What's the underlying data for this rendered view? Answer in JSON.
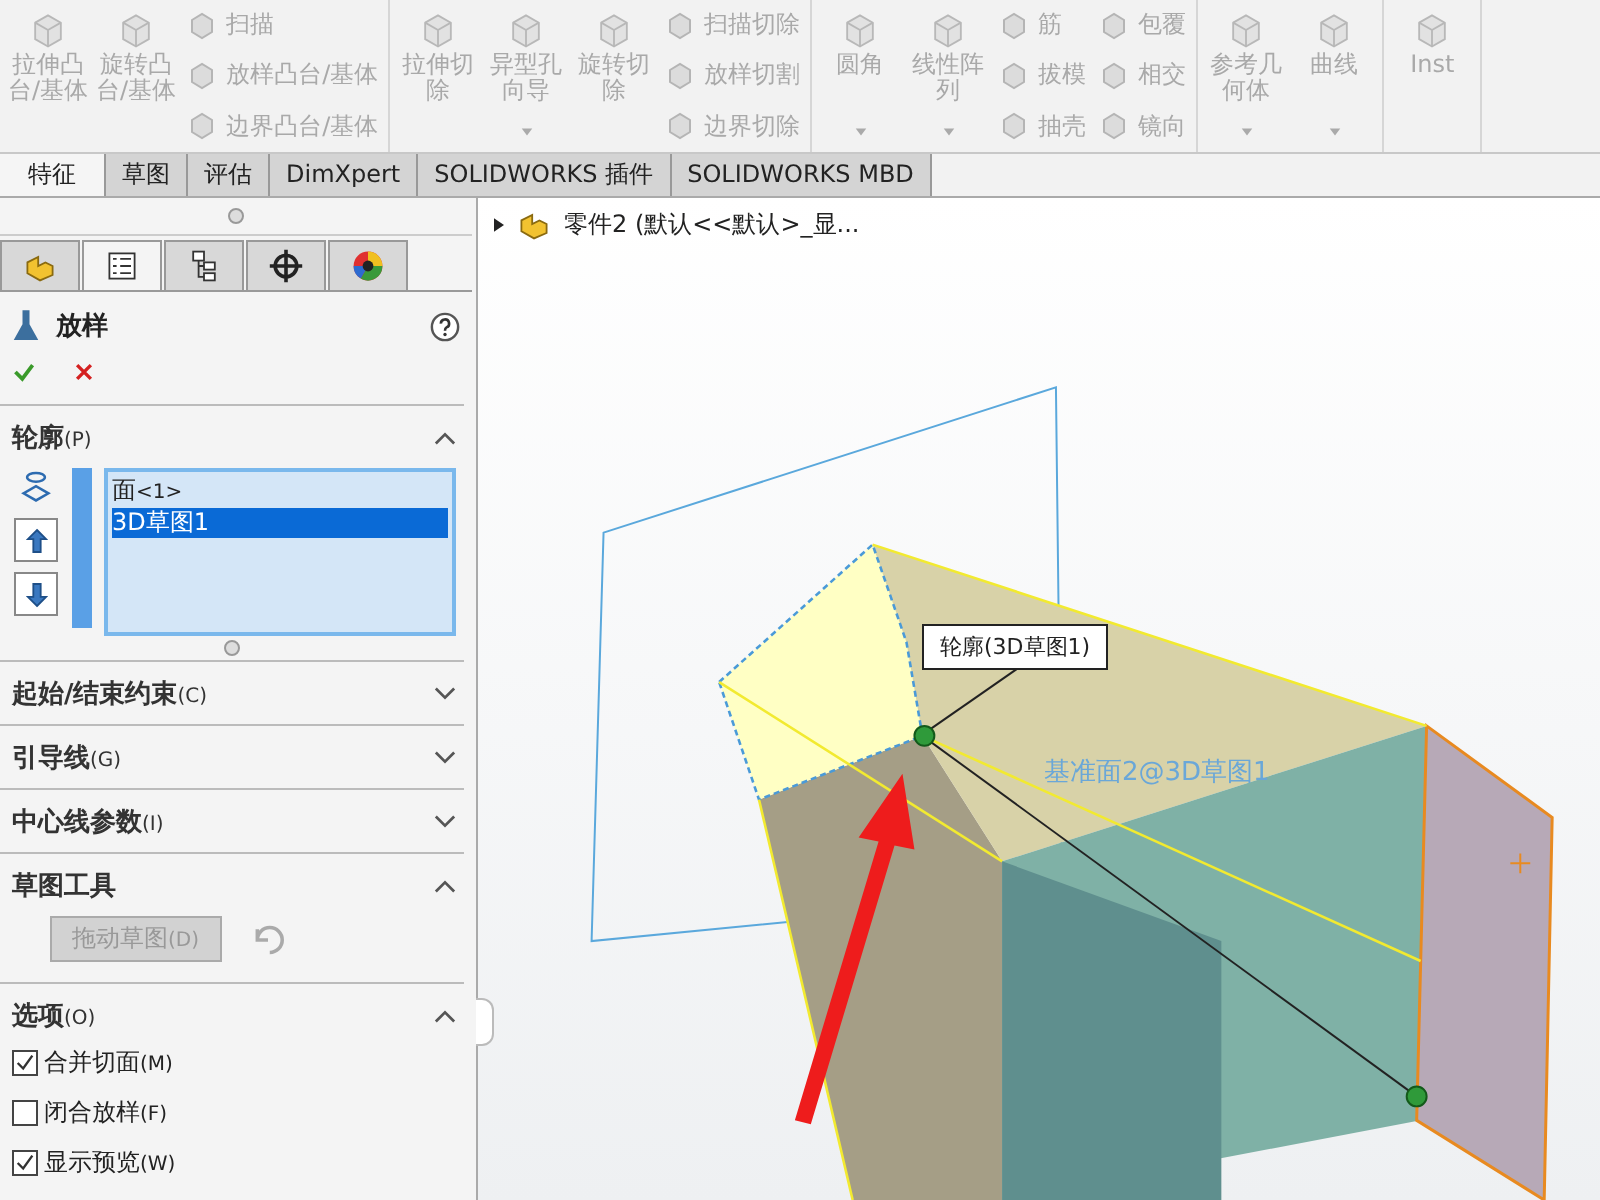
{
  "toolbar": {
    "groups": [
      {
        "items": [
          {
            "kind": "large",
            "lines": [
              "拉伸凸",
              "台/基体"
            ]
          },
          {
            "kind": "large",
            "lines": [
              "旋转凸",
              "台/基体"
            ]
          },
          {
            "kind": "column",
            "entries": [
              "扫描",
              "放样凸台/基体",
              "边界凸台/基体"
            ]
          }
        ]
      },
      {
        "items": [
          {
            "kind": "large",
            "lines": [
              "拉伸切",
              "除"
            ]
          },
          {
            "kind": "large",
            "lines": [
              "异型孔",
              "向导"
            ],
            "dropdown": true
          },
          {
            "kind": "large",
            "lines": [
              "旋转切",
              "除"
            ]
          },
          {
            "kind": "column",
            "entries": [
              "扫描切除",
              "放样切割",
              "边界切除"
            ]
          }
        ]
      },
      {
        "items": [
          {
            "kind": "large",
            "lines": [
              "圆角"
            ],
            "dropdown": true
          },
          {
            "kind": "large",
            "lines": [
              "线性阵",
              "列"
            ],
            "dropdown": true
          },
          {
            "kind": "column",
            "entries": [
              "筋",
              "拔模",
              "抽壳"
            ]
          },
          {
            "kind": "column",
            "entries": [
              "包覆",
              "相交",
              "镜向"
            ]
          }
        ]
      },
      {
        "items": [
          {
            "kind": "large",
            "lines": [
              "参考几",
              "何体"
            ],
            "dropdown": true
          },
          {
            "kind": "large",
            "lines": [
              "曲线"
            ],
            "dropdown": true
          }
        ]
      },
      {
        "items": [
          {
            "kind": "large",
            "lines": [
              "Inst"
            ]
          }
        ]
      }
    ]
  },
  "tabs": [
    {
      "label": "特征",
      "selected": true
    },
    {
      "label": "草图",
      "selected": false
    },
    {
      "label": "评估",
      "selected": false
    },
    {
      "label": "DimXpert",
      "selected": false
    },
    {
      "label": "SOLIDWORKS 插件",
      "selected": false
    },
    {
      "label": "SOLIDWORKS MBD",
      "selected": false
    }
  ],
  "panel": {
    "tabs": [
      {
        "kind": "part",
        "selected": false
      },
      {
        "kind": "property",
        "selected": true
      },
      {
        "kind": "config",
        "selected": false
      },
      {
        "kind": "crosshair",
        "selected": false
      },
      {
        "kind": "display",
        "selected": false
      }
    ],
    "title": "放样",
    "sections": [
      {
        "kind": "profiles",
        "label": "轮廓",
        "shortcut": "(P)",
        "expanded": true,
        "items": [
          {
            "label": "面",
            "suffix": "<1>",
            "selected": false
          },
          {
            "label": "3D草图1",
            "selected": true
          }
        ]
      },
      {
        "label": "起始/结束约束",
        "shortcut": "(C)",
        "expanded": false
      },
      {
        "label": "引导线",
        "shortcut": "(G)",
        "expanded": false
      },
      {
        "label": "中心线参数",
        "shortcut": "(I)",
        "expanded": false
      },
      {
        "kind": "tools",
        "label": "草图工具",
        "expanded": true,
        "button": {
          "label": "拖动草图",
          "shortcut": "(D)",
          "disabled": true
        }
      },
      {
        "kind": "options",
        "label": "选项",
        "shortcut": "(O)",
        "expanded": true,
        "checks": [
          {
            "label": "合并切面",
            "shortcut": "(M)",
            "checked": true
          },
          {
            "label": "闭合放样",
            "shortcut": "(F)",
            "checked": false
          },
          {
            "label": "显示预览",
            "shortcut": "(W)",
            "checked": true
          }
        ]
      }
    ]
  },
  "viewport": {
    "tree_label": "零件2 (默认<<默认>_显...",
    "callout": "轮廓(3D草图1)",
    "plane_label": "基准面2@3D草图1"
  }
}
